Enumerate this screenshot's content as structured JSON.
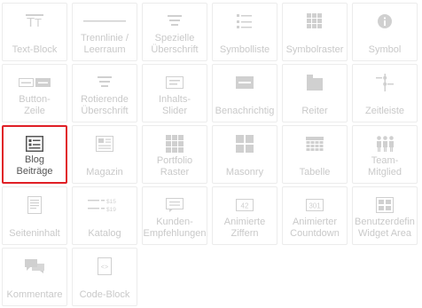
{
  "widgets": [
    {
      "label": "Text-Block",
      "icon": "text-block-icon"
    },
    {
      "label": "Trennlinie /\nLeerraum",
      "icon": "divider-icon"
    },
    {
      "label": "Spezielle\nÜberschrift",
      "icon": "special-heading-icon"
    },
    {
      "label": "Symbolliste",
      "icon": "icon-list-icon"
    },
    {
      "label": "Symbolraster",
      "icon": "icon-grid-icon"
    },
    {
      "label": "Symbol",
      "icon": "info-icon"
    },
    {
      "label": "Button-\nZeile",
      "icon": "button-row-icon"
    },
    {
      "label": "Rotierende\nÜberschrift",
      "icon": "rotating-heading-icon"
    },
    {
      "label": "Inhalts-\nSlider",
      "icon": "content-slider-icon"
    },
    {
      "label": "Benachrichtig",
      "icon": "notification-icon"
    },
    {
      "label": "Reiter",
      "icon": "tabs-icon"
    },
    {
      "label": "Zeitleiste",
      "icon": "timeline-icon"
    },
    {
      "label": "Blog\nBeiträge",
      "icon": "blog-posts-icon",
      "active": true
    },
    {
      "label": "Magazin",
      "icon": "magazine-icon"
    },
    {
      "label": "Portfolio\nRaster",
      "icon": "portfolio-grid-icon"
    },
    {
      "label": "Masonry",
      "icon": "masonry-icon"
    },
    {
      "label": "Tabelle",
      "icon": "table-icon"
    },
    {
      "label": "Team-\nMitglied",
      "icon": "team-member-icon"
    },
    {
      "label": "Seiteninhalt",
      "icon": "page-content-icon"
    },
    {
      "label": "Katalog",
      "icon": "catalog-icon"
    },
    {
      "label": "Kunden-\nEmpfehlungen",
      "icon": "testimonials-icon"
    },
    {
      "label": "Animierte\nZiffern",
      "icon": "animated-numbers-icon"
    },
    {
      "label": "Animierter\nCountdown",
      "icon": "countdown-icon"
    },
    {
      "label": "Benutzerdefin\nWidget Area",
      "icon": "widget-area-icon"
    },
    {
      "label": "Kommentare",
      "icon": "comments-icon"
    },
    {
      "label": "Code-Block",
      "icon": "code-block-icon"
    }
  ],
  "icon_texts": {
    "countdown": "301",
    "animated_numbers": "42",
    "catalog_price_a": "$15",
    "catalog_price_b": "$19"
  },
  "colors": {
    "active_border": "#e01f26",
    "tile_border": "#ececec",
    "icon_gray": "#cfcfcf",
    "active_icon": "#555555"
  }
}
